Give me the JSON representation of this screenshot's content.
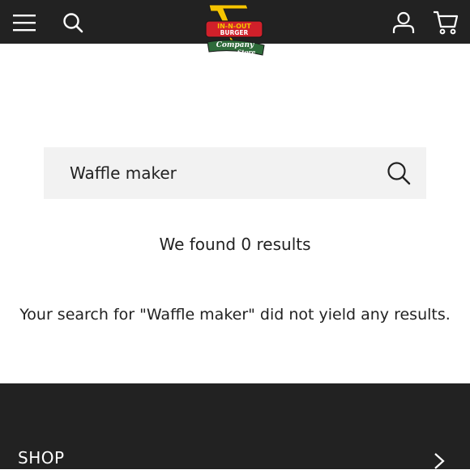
{
  "header": {
    "logo": {
      "line1": "IN-N-OUT",
      "line2": "BURGER",
      "line3": "Company",
      "line4": "Store"
    },
    "icons": {
      "menu": "hamburger-menu-icon",
      "search": "search-icon",
      "account": "user-account-icon",
      "cart": "shopping-cart-icon"
    }
  },
  "search": {
    "value": "Waffle maker",
    "submit_icon": "search-icon"
  },
  "results": {
    "count_text": "We found 0 results",
    "message": "Your search for \"Waffle maker\" did not yield any results."
  },
  "footer": {
    "shop_label": "SHOP",
    "chevron_icon": "chevron-right-icon"
  },
  "colors": {
    "header_bg": "#222222",
    "footer_bg": "#222222",
    "search_bg": "#f2f2f2",
    "text": "#222222",
    "logo_yellow": "#f5c400",
    "logo_red": "#d0202a",
    "logo_green": "#2e6b3a"
  }
}
